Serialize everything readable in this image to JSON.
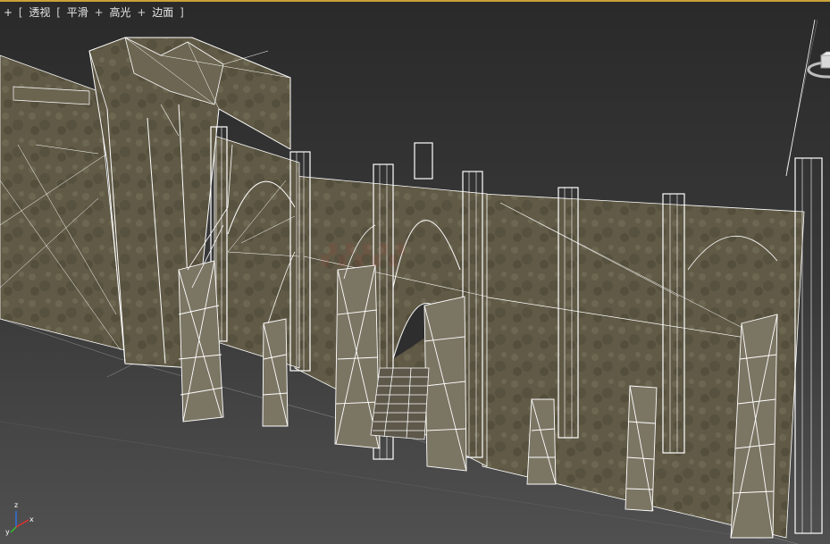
{
  "viewport": {
    "label": {
      "plus1": "+",
      "bracket1": "[",
      "view": "透视",
      "bracket2": "[",
      "shading": "平滑",
      "plus2": "+",
      "highlights": "高光",
      "plus3": "+",
      "edges": "边面",
      "bracket3": "]"
    },
    "axis": {
      "x": "x",
      "y": "y",
      "z": "z"
    },
    "colors": {
      "frame_accent": "#c9a23a",
      "wire": "#ffffff",
      "wall": "#6a6450",
      "wall_dark": "#4a4638",
      "ground_line": "#bfbfbf",
      "x_axis": "#e03030",
      "y_axis": "#30c030",
      "z_axis": "#3070e0"
    },
    "icons": [
      "viewcube-icon",
      "axis-tripod-icon"
    ]
  }
}
